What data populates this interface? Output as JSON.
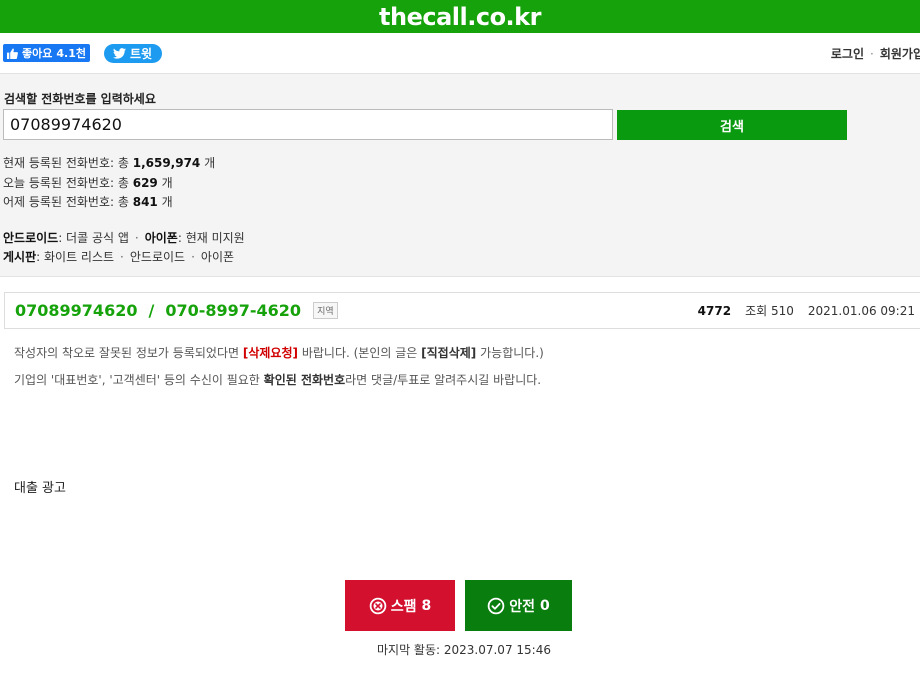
{
  "site": {
    "logo": "thecall.co.kr"
  },
  "social": {
    "like_label": "좋아요",
    "like_count": "4.1천",
    "tweet_label": "트윗"
  },
  "auth": {
    "login": "로그인",
    "signup": "회원가입"
  },
  "search": {
    "label": "검색할 전화번호를 입력하세요",
    "value": "07089974620",
    "button": "검색"
  },
  "stats": {
    "total_prefix": "현재 등록된 전화번호: 총",
    "total_value": "1,659,974",
    "today_prefix": "오늘 등록된 전화번호: 총",
    "today_value": "629",
    "yesterday_prefix": "어제 등록된 전화번호: 총",
    "yesterday_value": "841",
    "unit": "개"
  },
  "links": {
    "android_label": "안드로이드",
    "android_text": ": 더콜 공식 앱",
    "iphone_label": "아이폰",
    "iphone_text": ": 현재 미지원",
    "board_label": "게시판",
    "board_items": [
      "화이트 리스트",
      "안드로이드",
      "아이폰"
    ]
  },
  "record": {
    "number_plain": "07089974620",
    "number_formatted": "070-8997-4620",
    "region_tag": "지역",
    "id": "4772",
    "views_label": "조회",
    "views_value": "510",
    "datetime": "2021.01.06 09:21"
  },
  "notice": {
    "line1_pre": "작성자의 착오로 잘못된 정보가 등록되었다면",
    "line1_red": "[삭제요청]",
    "line1_mid": "바랍니다. (본인의 글은",
    "line1_bold": "[직접삭제]",
    "line1_post": "가능합니다.)",
    "line2_pre": "기업의 '대표번호', '고객센터' 등의 수신이 필요한",
    "line2_bold": "확인된 전화번호",
    "line2_post": "라면 댓글/투표로 알려주시길 바랍니다."
  },
  "ad_label": "대출 광고",
  "votes": {
    "spam_label": "스팸",
    "spam_count": "8",
    "safe_label": "안전",
    "safe_count": "0"
  },
  "last_activity": "마지막 활동: 2023.07.07 15:46",
  "colors": {
    "brand_green": "#16a20a",
    "spam_red": "#d3112f",
    "safe_green": "#0a7d0f"
  }
}
